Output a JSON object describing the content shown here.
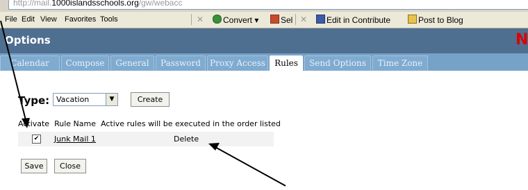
{
  "browser": {
    "address_text": "http://mail.1000islandsschools.org/gw/webacc",
    "address_gray_prefix": "http://mail.",
    "address_bold": "1000islandsschools.org",
    "address_gray_suffix": "/gw/webacc",
    "menu": [
      "File",
      "Edit",
      "View",
      "Favorites",
      "Tools"
    ],
    "toolbar": {
      "convert_label": "Convert",
      "select_label": "Sel",
      "edit_contribute_label": "Edit in Contribute",
      "post_blog_label": "Post to Blog"
    }
  },
  "options": {
    "title": "Options",
    "brand_letter": "N",
    "tabs": [
      "Calendar",
      "Compose",
      "General",
      "Password",
      "Proxy Access",
      "Rules",
      "Send Options",
      "Time Zone"
    ],
    "active_tab": "Rules"
  },
  "rules": {
    "type_label": "Type:",
    "type_value": "Vacation",
    "create_label": "Create",
    "header_activate": "Activate",
    "header_rule_name": "Rule Name",
    "header_note": "Active rules will be executed in the order listed",
    "rows": [
      {
        "name": "Junk Mail 1",
        "checked": true,
        "delete_label": "Delete"
      }
    ],
    "save_label": "Save",
    "close_label": "Close"
  },
  "colors": {
    "options_bar": "#4f6f91",
    "tab_bar": "#77a2c7",
    "brand": "#dd0000"
  }
}
